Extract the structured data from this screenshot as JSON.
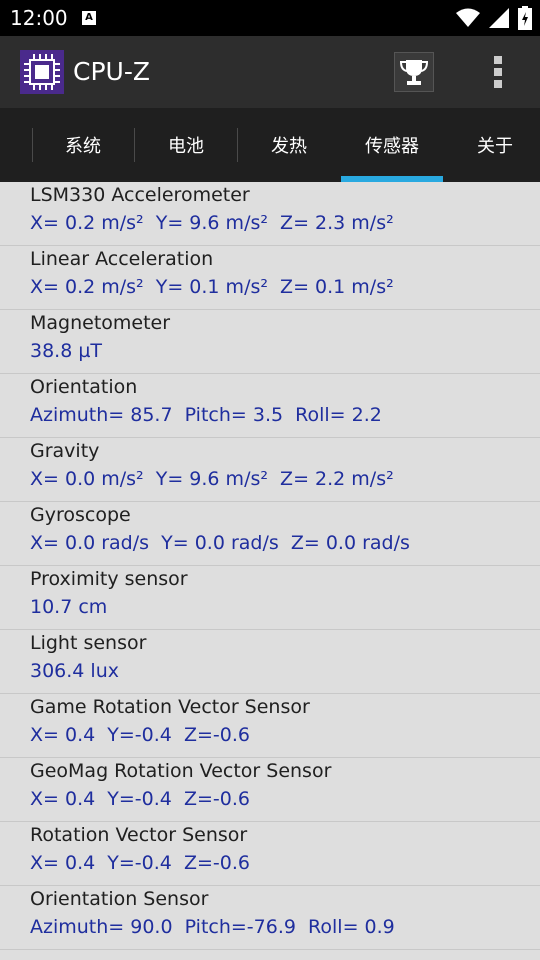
{
  "status_bar": {
    "time": "12:00",
    "notification_letter": "A"
  },
  "app_bar": {
    "title": "CPU-Z",
    "icons": [
      "cpu-chip-icon",
      "trophy-icon",
      "overflow-menu-icon"
    ]
  },
  "tabs": [
    {
      "label": "系统",
      "selected": false
    },
    {
      "label": "电池",
      "selected": false
    },
    {
      "label": "发热",
      "selected": false
    },
    {
      "label": "传感器",
      "selected": true
    },
    {
      "label": "关于",
      "selected": false
    }
  ],
  "colors": {
    "accent": "#29a9e0",
    "value_text": "#1f2e9e",
    "background": "#dedede"
  },
  "sensors": [
    {
      "name": "LSM330 Accelerometer",
      "value": "X= 0.2 m/s²  Y= 9.6 m/s²  Z= 2.3 m/s²"
    },
    {
      "name": "Linear Acceleration",
      "value": "X= 0.2 m/s²  Y= 0.1 m/s²  Z= 0.1 m/s²"
    },
    {
      "name": "Magnetometer",
      "value": "38.8 µT"
    },
    {
      "name": "Orientation",
      "value": "Azimuth= 85.7  Pitch= 3.5  Roll= 2.2"
    },
    {
      "name": "Gravity",
      "value": "X= 0.0 m/s²  Y= 9.6 m/s²  Z= 2.2 m/s²"
    },
    {
      "name": "Gyroscope",
      "value": "X= 0.0 rad/s  Y= 0.0 rad/s  Z= 0.0 rad/s"
    },
    {
      "name": "Proximity sensor",
      "value": "10.7 cm"
    },
    {
      "name": "Light sensor",
      "value": "306.4 lux"
    },
    {
      "name": "Game Rotation Vector Sensor",
      "value": "X= 0.4  Y=-0.4  Z=-0.6"
    },
    {
      "name": "GeoMag Rotation Vector Sensor",
      "value": "X= 0.4  Y=-0.4  Z=-0.6"
    },
    {
      "name": "Rotation Vector Sensor",
      "value": "X= 0.4  Y=-0.4  Z=-0.6"
    },
    {
      "name": "Orientation Sensor",
      "value": "Azimuth= 90.0  Pitch=-76.9  Roll= 0.9"
    }
  ]
}
